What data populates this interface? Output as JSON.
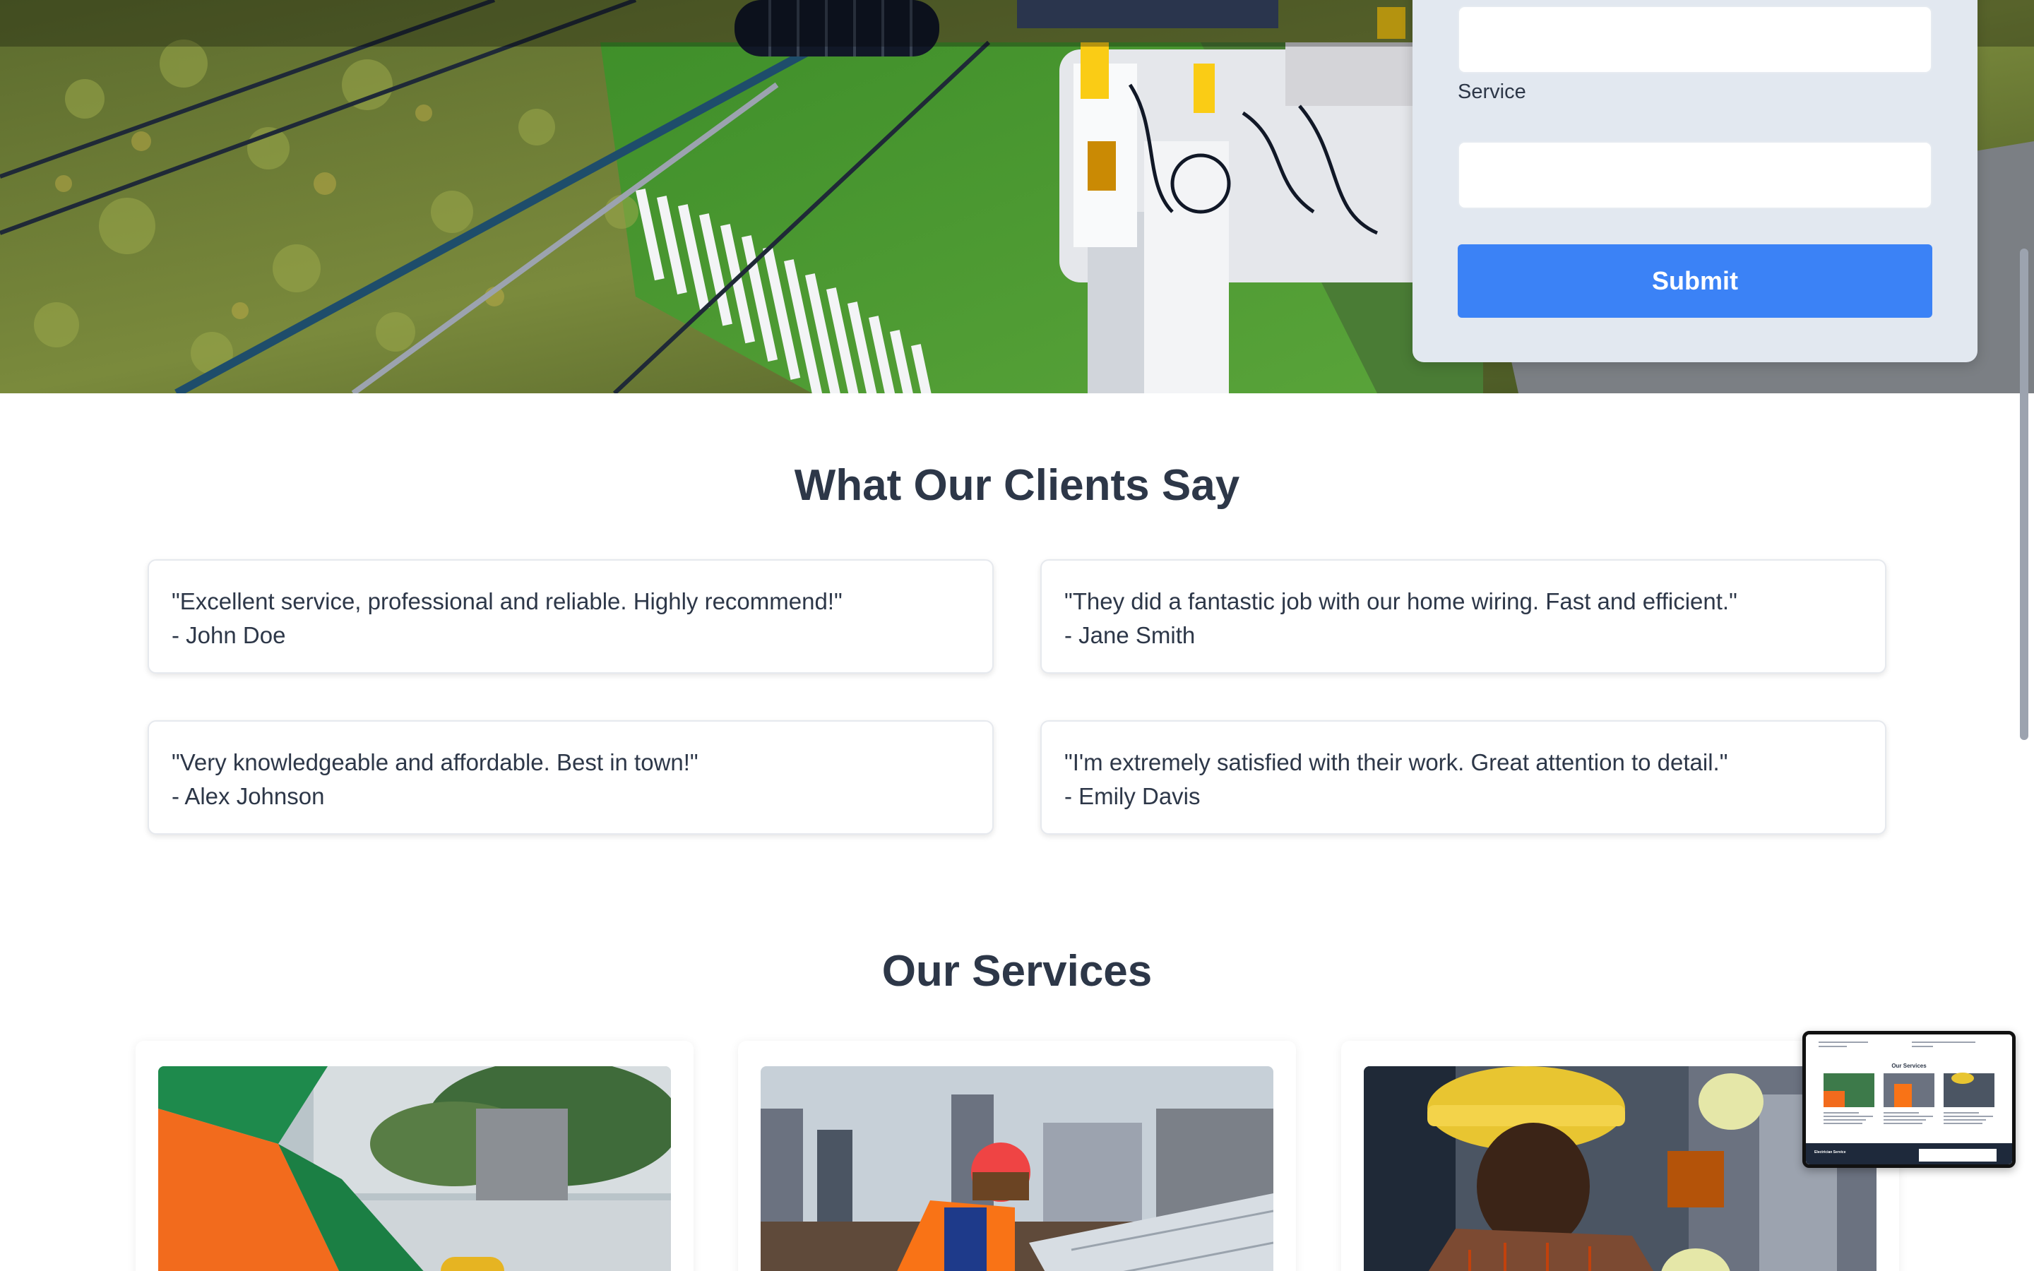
{
  "contact_form": {
    "service_label": "Service",
    "submit_label": "Submit"
  },
  "testimonials": {
    "title": "What Our Clients Say",
    "items": [
      {
        "quote": "\"Excellent service, professional and reliable. Highly recommend!\"",
        "author": "- John Doe"
      },
      {
        "quote": "\"They did a fantastic job with our home wiring. Fast and efficient.\"",
        "author": "- Jane Smith"
      },
      {
        "quote": "\"Very knowledgeable and affordable. Best in town!\"",
        "author": "- Alex Johnson"
      },
      {
        "quote": "\"I'm extremely satisfied with their work. Great attention to detail.\"",
        "author": "- Emily Davis"
      }
    ]
  },
  "services": {
    "title": "Our Services"
  },
  "thumbnail": {
    "title": "Our Services",
    "footer_text": "Electrician Service"
  },
  "colors": {
    "primary_button": "#3b82f6",
    "heading_text": "#2d3748",
    "form_background": "#e2e8f0"
  }
}
